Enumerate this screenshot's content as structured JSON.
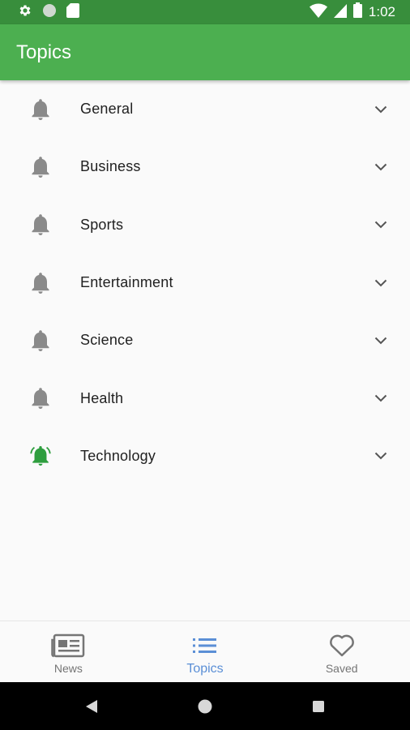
{
  "status_bar": {
    "time": "1:02",
    "left_icons": [
      "gear-icon",
      "circle-icon",
      "sd-card-icon"
    ],
    "right_icons": [
      "wifi-icon",
      "cell-signal-icon",
      "battery-icon"
    ]
  },
  "app_bar": {
    "title": "Topics",
    "color": "#4caf50"
  },
  "topics": [
    {
      "label": "General",
      "subscribed": false
    },
    {
      "label": "Business",
      "subscribed": false
    },
    {
      "label": "Sports",
      "subscribed": false
    },
    {
      "label": "Entertainment",
      "subscribed": false
    },
    {
      "label": "Science",
      "subscribed": false
    },
    {
      "label": "Health",
      "subscribed": false
    },
    {
      "label": "Technology",
      "subscribed": true
    }
  ],
  "colors": {
    "icon_inactive": "#8a8a8a",
    "icon_active": "#2e9e3e",
    "nav_active": "#5b8fd6"
  },
  "bottom_nav": {
    "items": [
      {
        "label": "News",
        "icon": "newspaper-icon",
        "active": false
      },
      {
        "label": "Topics",
        "icon": "list-icon",
        "active": true
      },
      {
        "label": "Saved",
        "icon": "heart-icon",
        "active": false
      }
    ]
  },
  "system_nav": {
    "buttons": [
      "back-icon",
      "home-icon",
      "recents-icon"
    ]
  }
}
